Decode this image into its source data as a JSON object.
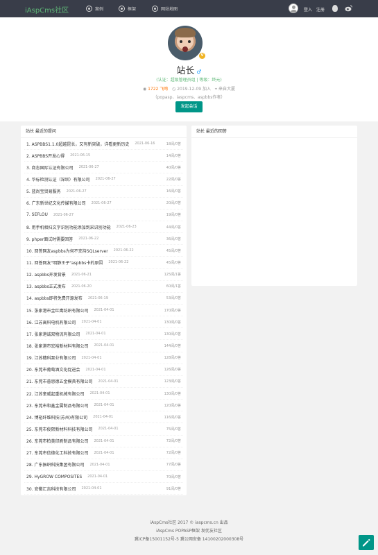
{
  "header": {
    "logo": "iAspCms社区",
    "nav": [
      {
        "label": "案例",
        "icon": "case-icon"
      },
      {
        "label": "框架",
        "icon": "ui-icon"
      },
      {
        "label": "网站地图",
        "icon": "sitemap-icon"
      }
    ],
    "login": "登入",
    "register": "注册"
  },
  "profile": {
    "name": "站长",
    "vip": "V",
    "role_line": "(认证：超级管理员组 | 等级：终元)",
    "kiss": "1722 飞吻",
    "joined": "2019-12-09 加入",
    "location": "来自大厦",
    "sign": "（popasp、iaspcms、aspbbs作者）",
    "message_button": "发起会话"
  },
  "left_panel": {
    "title": "站长 最近的提问",
    "posts": [
      {
        "title": "1. ASPBBS1.1.0超越昆长，又有新突破，详看更新历史",
        "date": "2021-06-16",
        "stat": "18阅/0答"
      },
      {
        "title": "2. ASPBBS开发心得",
        "date": "2021-06-15",
        "stat": "14阅/0答"
      },
      {
        "title": "3. 商志国际认证有限公司",
        "date": "2021-06-27",
        "stat": "40阅/0答"
      },
      {
        "title": "4. 华标检测认证（深圳）有限公司",
        "date": "2021-06-27",
        "stat": "22阅/0答"
      },
      {
        "title": "5. 蓝尚宝贸易服务",
        "date": "2021-06-27",
        "stat": "16阅/0答"
      },
      {
        "title": "6. 广东新世纪文化传媒有限公司",
        "date": "2021-06-27",
        "stat": "20阅/0答"
      },
      {
        "title": "7. SEFLOU",
        "date": "2021-06-27",
        "stat": "19阅/0答"
      },
      {
        "title": "8. 用手机相扫文字识别功能添加到采识别功能",
        "date": "2021-06-23",
        "stat": "44阅/0答"
      },
      {
        "title": "9. phper面试时需要回答",
        "date": "2021-06-22",
        "stat": "36阅/0答"
      },
      {
        "title": "10. 回答网友aspbbs为何不支持SQLserver",
        "date": "2021-06-22",
        "stat": "45阅/0答"
      },
      {
        "title": "11. 回答网友\"明静王子\"aspbbs卡的原因",
        "date": "2021-06-22",
        "stat": "45阅/0答"
      },
      {
        "title": "12. aspbbs开发背景",
        "date": "2021-06-21",
        "stat": "125阅/1答"
      },
      {
        "title": "13. aspbbs正式发布",
        "date": "2021-06-20",
        "stat": "60阅/1答"
      },
      {
        "title": "14. aspbbs即将免费开源发布",
        "date": "2021-06-19",
        "stat": "53阅/0答"
      },
      {
        "title": "15. 张家港市金红鹰纺织有限公司",
        "date": "2021-04-01",
        "stat": "170阅/0答"
      },
      {
        "title": "16. 江苏高科电机有限公司",
        "date": "2021-04-01",
        "stat": "130阅/0答"
      },
      {
        "title": "17. 张家港诚双物流有限公司",
        "date": "2021-04-01",
        "stat": "130阅/0答"
      },
      {
        "title": "18. 张家港市宏裕新材料有限公司",
        "date": "2021-04-01",
        "stat": "144阅/0答"
      },
      {
        "title": "19. 江苏穗科泵业有限公司",
        "date": "2021-04-01",
        "stat": "128阅/0答"
      },
      {
        "title": "20. 东莞市葡萄酒文化促进会",
        "date": "2021-04-01",
        "stat": "126阅/0答"
      },
      {
        "title": "21. 东莞市普思德五金模具有限公司",
        "date": "2021-04-01",
        "stat": "123阅/0答"
      },
      {
        "title": "22. 江苏奎威起重机械有限公司",
        "date": "2021-04-01",
        "stat": "130阅/0答"
      },
      {
        "title": "23. 东莞市和鑫金属制品有限公司",
        "date": "2021-04-01",
        "stat": "120阅/0答"
      },
      {
        "title": "24. 博裕纤维科技(苏州)有限公司",
        "date": "2021-04-01",
        "stat": "116阅/0答"
      },
      {
        "title": "25. 东莞市俊熙新材料科技有限公司",
        "date": "2021-04-01",
        "stat": "75阅/0答"
      },
      {
        "title": "26. 东莞市柏美印刷制品有限公司",
        "date": "2021-04-01",
        "stat": "72阅/0答"
      },
      {
        "title": "27. 东莞市信德化工科技有限公司",
        "date": "2021-04-01",
        "stat": "72阅/0答"
      },
      {
        "title": "28. 广东振织科技集团有限公司",
        "date": "2021-04-01",
        "stat": "77阅/0答"
      },
      {
        "title": "29. HyGROW COMPOSITES",
        "date": "2021-04-01",
        "stat": "70阅/0答"
      },
      {
        "title": "30. 安徽汇吉科技有限公司",
        "date": "2021-04-01",
        "stat": "91阅/0答"
      }
    ]
  },
  "right_panel": {
    "title": "站长 最近的回答"
  },
  "footer": {
    "line1": "iAspCms社区  2017 ©  iaspcms.cn 出品",
    "line2": "iAspCms    POPASP框架    发优友社区",
    "line3": "冀ICP备15001152号-5    冀公网安备 14100202000308号"
  },
  "colors": {
    "topbar": "#393d49",
    "brand_green": "#5fb878",
    "button_teal": "#009688",
    "kiss_orange": "#ff7200"
  }
}
